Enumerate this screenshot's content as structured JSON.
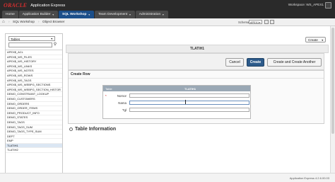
{
  "header": {
    "brand": "ORACLE",
    "app_name": "Application Express",
    "workspace": "Workspace: WS_APEX1",
    "tabs": [
      {
        "label": "Home",
        "active": false,
        "caret": false
      },
      {
        "label": "Application Builder",
        "active": false,
        "caret": true
      },
      {
        "label": "SQL Workshop",
        "active": true,
        "caret": true
      },
      {
        "label": "Team Development",
        "active": false,
        "caret": true
      },
      {
        "label": "Administration",
        "active": false,
        "caret": true
      }
    ]
  },
  "breadcrumb": {
    "items": [
      "SQL Workshop",
      "Object Browser"
    ],
    "schema_label": "Schema",
    "schema_value": "APEX1"
  },
  "sidebar": {
    "object_type": "Tables",
    "search_value": "",
    "objects": [
      "APEX$_ACL",
      "APEX$_WS_FILES",
      "APEX$_WS_HISTORY",
      "APEX$_WS_LINKS",
      "APEX$_WS_NOTES",
      "APEX$_WS_ROWS",
      "APEX$_WS_TAGS",
      "APEX$_WS_WEBPG_SECTIONS",
      "APEX$_WS_WEBPG_SECTION_HISTOR",
      "DEMO_CONSTRAINT_LOOKUP",
      "DEMO_CUSTOMERS",
      "DEMO_ORDERS",
      "DEMO_ORDER_ITEMS",
      "DEMO_PRODUCT_INFO",
      "DEMO_STATES",
      "DEMO_TAGS",
      "DEMO_TAGS_SUM",
      "DEMO_TAGS_TYPE_SUM",
      "DEPT",
      "EMP",
      "TLATIH1",
      "TLATIH2"
    ],
    "selected": "TLATIH1"
  },
  "main": {
    "object_title": "TLATIH1",
    "create_menu": "Create",
    "buttons": {
      "cancel": "Cancel",
      "create": "Create",
      "create_another": "Create and Create Another"
    },
    "region_title": "Create Row",
    "grid": {
      "header_key": "Table",
      "header_value": "TLATIH1",
      "rows": [
        {
          "label": "Nomor",
          "required": true,
          "value": ""
        },
        {
          "label": "Nama",
          "required": false,
          "value": ""
        },
        {
          "label": "Tgl",
          "required": false,
          "value": ""
        }
      ]
    },
    "table_info": "Table Information"
  },
  "footer": {
    "version": "Application Express 4.2.6.00.03"
  }
}
